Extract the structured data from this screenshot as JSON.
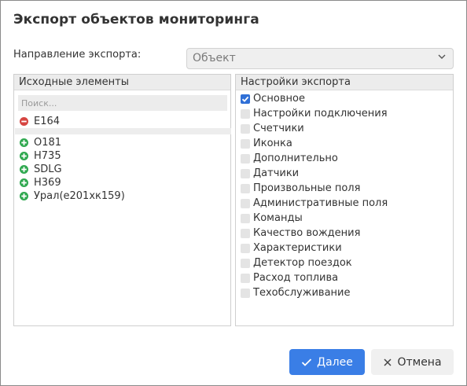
{
  "dialog": {
    "title": "Экспорт объектов мониторинга"
  },
  "direction": {
    "label": "Направление экспорта:",
    "value": "Объект"
  },
  "source": {
    "header": "Исходные элементы",
    "search_placeholder": "Поиск...",
    "selected": [
      {
        "label": "E164",
        "icon": "minus-circle-icon"
      }
    ],
    "available": [
      {
        "label": "O181",
        "icon": "plus-circle-icon"
      },
      {
        "label": "H735",
        "icon": "plus-circle-icon"
      },
      {
        "label": "SDLG",
        "icon": "plus-circle-icon"
      },
      {
        "label": "H369",
        "icon": "plus-circle-icon"
      },
      {
        "label": "Урал(е201хк159)",
        "icon": "plus-circle-icon"
      }
    ]
  },
  "settings": {
    "header": "Настройки экспорта",
    "options": [
      {
        "label": "Основное",
        "checked": true
      },
      {
        "label": "Настройки подключения",
        "checked": false
      },
      {
        "label": "Счетчики",
        "checked": false
      },
      {
        "label": "Иконка",
        "checked": false
      },
      {
        "label": "Дополнительно",
        "checked": false
      },
      {
        "label": "Датчики",
        "checked": false
      },
      {
        "label": "Произвольные поля",
        "checked": false
      },
      {
        "label": "Административные поля",
        "checked": false
      },
      {
        "label": "Команды",
        "checked": false
      },
      {
        "label": "Качество вождения",
        "checked": false
      },
      {
        "label": "Характеристики",
        "checked": false
      },
      {
        "label": "Детектор поездок",
        "checked": false
      },
      {
        "label": "Расход топлива",
        "checked": false
      },
      {
        "label": "Техобслуживание",
        "checked": false
      }
    ]
  },
  "buttons": {
    "next": "Далее",
    "cancel": "Отмена"
  },
  "colors": {
    "primary": "#3a7ee6",
    "minus": "#d64541",
    "plus": "#2fa84f"
  }
}
